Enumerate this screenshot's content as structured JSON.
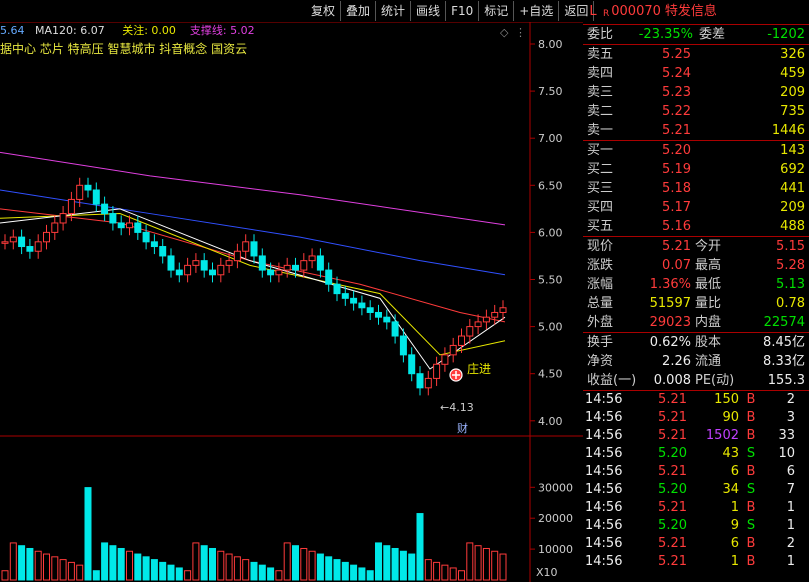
{
  "toolbar": [
    "复权",
    "叠加",
    "统计",
    "画线",
    "F10",
    "标记",
    "+自选",
    "返回"
  ],
  "info_bar": {
    "ma_prev": "5.64",
    "ma120_label": "MA120: 6.07",
    "focus_label": "关注: 0.00",
    "support_label": "支撑线: 5.02"
  },
  "concepts": "据中心 芯片 特高压 智慧城市 抖音概念 国资云",
  "price_axis": [
    "8.00",
    "7.50",
    "7.00",
    "6.50",
    "6.00",
    "5.50",
    "5.00",
    "4.50",
    "4.00"
  ],
  "volume_axis": [
    "30000",
    "20000",
    "10000"
  ],
  "volume_unit": "X10",
  "annotations": {
    "low_label": "←4.13",
    "caidan": "财",
    "zhuangjin": "庄进"
  },
  "stock": {
    "prefix": "L",
    "badge": "R",
    "code": "000070",
    "name": "特发信息"
  },
  "commission": {
    "ratio_label": "委比",
    "ratio": "-23.35%",
    "diff_label": "委差",
    "diff": "-1202"
  },
  "asks": [
    {
      "label": "卖五",
      "price": "5.25",
      "vol": "326"
    },
    {
      "label": "卖四",
      "price": "5.24",
      "vol": "459"
    },
    {
      "label": "卖三",
      "price": "5.23",
      "vol": "209"
    },
    {
      "label": "卖二",
      "price": "5.22",
      "vol": "735"
    },
    {
      "label": "卖一",
      "price": "5.21",
      "vol": "1446"
    }
  ],
  "bids": [
    {
      "label": "买一",
      "price": "5.20",
      "vol": "143"
    },
    {
      "label": "买二",
      "price": "5.19",
      "vol": "692"
    },
    {
      "label": "买三",
      "price": "5.18",
      "vol": "441"
    },
    {
      "label": "买四",
      "price": "5.17",
      "vol": "209"
    },
    {
      "label": "买五",
      "price": "5.16",
      "vol": "488"
    }
  ],
  "quote": [
    {
      "l1": "现价",
      "v1": "5.21",
      "c1": "red",
      "l2": "今开",
      "v2": "5.15",
      "c2": "red"
    },
    {
      "l1": "涨跌",
      "v1": "0.07",
      "c1": "red",
      "l2": "最高",
      "v2": "5.28",
      "c2": "red"
    },
    {
      "l1": "涨幅",
      "v1": "1.36%",
      "c1": "red",
      "l2": "最低",
      "v2": "5.13",
      "c2": "green"
    },
    {
      "l1": "总量",
      "v1": "51597",
      "c1": "yellow",
      "l2": "量比",
      "v2": "0.78",
      "c2": "yellow"
    },
    {
      "l1": "外盘",
      "v1": "29023",
      "c1": "red",
      "l2": "内盘",
      "v2": "22574",
      "c2": "green"
    }
  ],
  "stats": [
    {
      "l1": "换手",
      "v1": "0.62%",
      "l2": "股本",
      "v2": "8.45亿"
    },
    {
      "l1": "净资",
      "v1": "2.26",
      "l2": "流通",
      "v2": "8.33亿"
    },
    {
      "l1": "收益(一)",
      "v1": "0.008",
      "l2": "PE(动)",
      "v2": "155.3"
    }
  ],
  "ticks": [
    {
      "time": "14:56",
      "price": "5.21",
      "vol": "150",
      "dir": "B",
      "n": "2"
    },
    {
      "time": "14:56",
      "price": "5.21",
      "vol": "90",
      "dir": "B",
      "n": "3"
    },
    {
      "time": "14:56",
      "price": "5.21",
      "vol": "1502",
      "dir": "B",
      "n": "33"
    },
    {
      "time": "14:56",
      "price": "5.20",
      "vol": "43",
      "dir": "S",
      "n": "10"
    },
    {
      "time": "14:56",
      "price": "5.21",
      "vol": "6",
      "dir": "B",
      "n": "6"
    },
    {
      "time": "14:56",
      "price": "5.20",
      "vol": "34",
      "dir": "S",
      "n": "7"
    },
    {
      "time": "14:56",
      "price": "5.21",
      "vol": "1",
      "dir": "B",
      "n": "1"
    },
    {
      "time": "14:56",
      "price": "5.20",
      "vol": "9",
      "dir": "S",
      "n": "1"
    },
    {
      "time": "14:56",
      "price": "5.21",
      "vol": "6",
      "dir": "B",
      "n": "2"
    },
    {
      "time": "14:56",
      "price": "5.21",
      "vol": "1",
      "dir": "B",
      "n": "1"
    }
  ],
  "colors": {
    "up": "#ff3b3b",
    "down": "#00e8e8",
    "ma5": "#ffffff",
    "ma10": "#e8e800",
    "ma20": "#ff3b3b",
    "ma60": "#3050ff",
    "ma120": "#e040e0",
    "grid": "#aa0000"
  }
}
